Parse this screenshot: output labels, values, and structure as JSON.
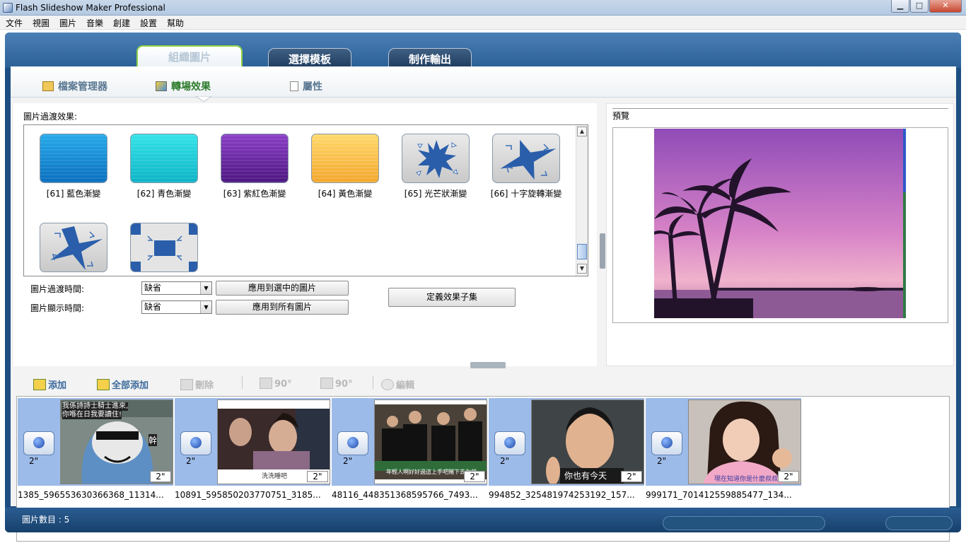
{
  "window": {
    "title": "Flash Slideshow Maker Professional",
    "minimize": "▁",
    "maximize": "□",
    "close": "✕"
  },
  "menu": [
    "文件",
    "視圖",
    "圖片",
    "音樂",
    "創建",
    "設置",
    "幫助"
  ],
  "main_tabs": [
    "組織圖片",
    "選擇模板",
    "制作輸出"
  ],
  "sub_tabs": [
    "檔案管理器",
    "轉場效果",
    "屬性"
  ],
  "effects_panel": {
    "label": "圖片過渡效果:",
    "effects": [
      {
        "label": "[61] 藍色漸變",
        "icon": "blue-gradient"
      },
      {
        "label": "[62] 青色漸變",
        "icon": "cyan-gradient"
      },
      {
        "label": "[63] 紫紅色漸變",
        "icon": "purple-gradient"
      },
      {
        "label": "[64] 黃色漸變",
        "icon": "yellow-gradient"
      },
      {
        "label": "[65] 光芒狀漸變",
        "icon": "starburst"
      },
      {
        "label": "[66] 十字旋轉漸變",
        "icon": "cross-rotate"
      },
      {
        "label": "",
        "icon": "cross-rotate-2"
      },
      {
        "label": "",
        "icon": "square-converge"
      }
    ],
    "transition_time_label": "圖片過渡時間:",
    "display_time_label": "圖片顯示時間:",
    "transition_time_value": "缺省",
    "display_time_value": "缺省",
    "apply_selected": "應用到選中的圖片",
    "apply_all": "應用到所有圖片",
    "define_subset": "定義效果子集"
  },
  "preview": {
    "label": "預覽",
    "image": "purple-sunset-palm-trees"
  },
  "toolbar": {
    "add": "添加",
    "add_all": "全部添加",
    "delete": "刪除",
    "rotate_left": "90°",
    "rotate_right": "90°",
    "edit": "編輯"
  },
  "filmstrip": {
    "transitions": [
      "2\"",
      "2\"",
      "2\"",
      "2\"",
      "2\""
    ],
    "slides": [
      {
        "filename": "1385_596553630366368_11314...",
        "duration": "2\"",
        "caption1": "我係詩詩士騎士進來,",
        "caption2": "你喺在日我要讀住!",
        "side": "幹"
      },
      {
        "filename": "10891_595850203770751_3185...",
        "duration": "2\"",
        "caption": "洗洗睡吧"
      },
      {
        "filename": "48116_448351368595766_7493...",
        "duration": "2\"",
        "caption": "年輕人啊好好過這上手吧賭下去你就"
      },
      {
        "filename": "994852_325481974253192_157...",
        "duration": "2\"",
        "caption": "你也有今天"
      },
      {
        "filename": "999171_701412559885477_134...",
        "duration": "2\"",
        "caption": "現在知道你是什麼叔叔"
      }
    ]
  },
  "status": {
    "count_text": "圖片數目 : 5"
  }
}
